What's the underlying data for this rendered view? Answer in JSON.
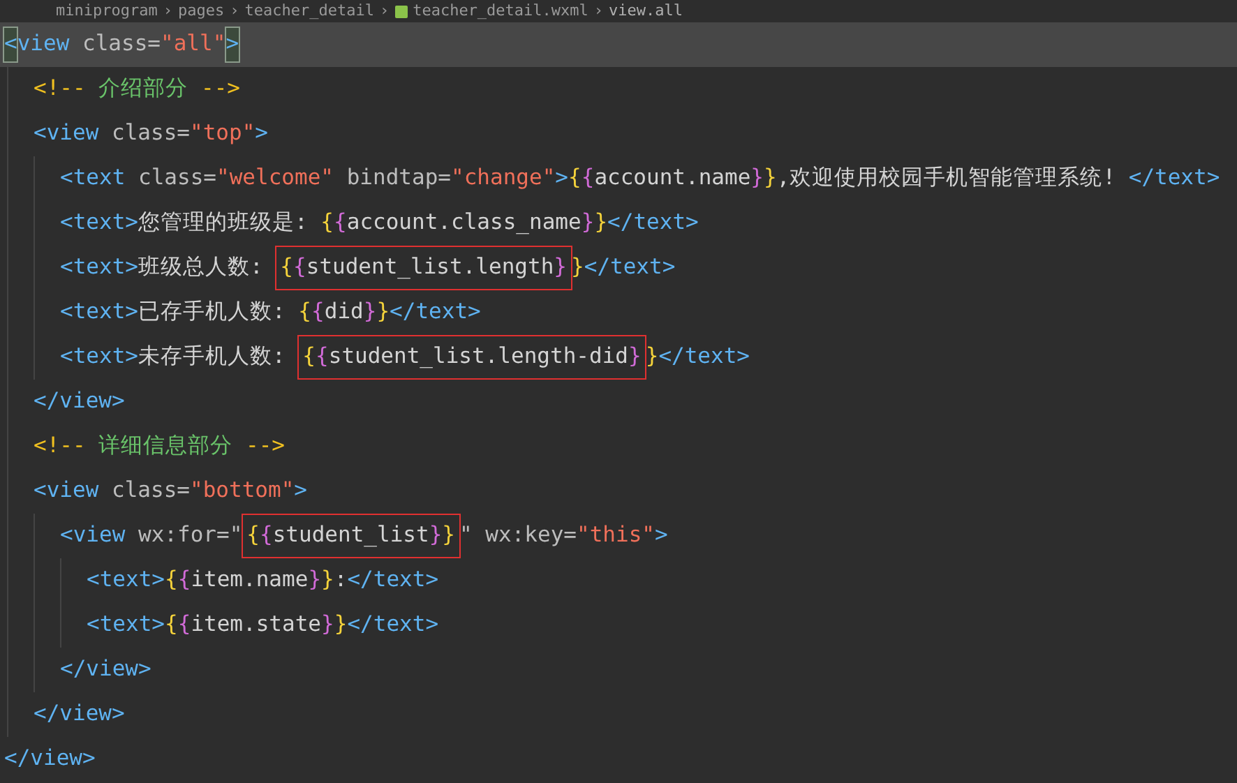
{
  "breadcrumb": [
    {
      "text": "miniprogram",
      "kind": "folder"
    },
    {
      "text": "›",
      "kind": "separator"
    },
    {
      "text": "pages",
      "kind": "folder"
    },
    {
      "text": "›",
      "kind": "separator"
    },
    {
      "text": "teacher_detail",
      "kind": "folder"
    },
    {
      "text": "›",
      "kind": "separator"
    },
    {
      "text": "teacher_detail.wxml",
      "kind": "file"
    },
    {
      "text": "›",
      "kind": "separator"
    },
    {
      "text": "view.all",
      "kind": "symbol"
    }
  ],
  "lines": [
    {
      "current": true,
      "tokens": [
        {
          "kind": "tag",
          "text": "<",
          "matched": true
        },
        {
          "kind": "tag",
          "text": "view "
        },
        {
          "kind": "attr",
          "text": "class="
        },
        {
          "kind": "string",
          "text": "\"all\""
        },
        {
          "kind": "tag",
          "text": ">",
          "matched": true
        }
      ],
      "children": [
        {
          "tokens": [
            {
              "kind": "punct",
              "text": "<!--"
            },
            {
              "kind": "comment",
              "text": " 介绍部分 "
            },
            {
              "kind": "punct",
              "text": "-->"
            }
          ]
        },
        {
          "tokens": [
            {
              "kind": "tag",
              "text": "<view "
            },
            {
              "kind": "attr",
              "text": "class="
            },
            {
              "kind": "string",
              "text": "\"top\""
            },
            {
              "kind": "tag",
              "text": ">"
            }
          ],
          "children": [
            {
              "tokens": [
                {
                  "kind": "tag",
                  "text": "<text "
                },
                {
                  "kind": "attr",
                  "text": "class="
                },
                {
                  "kind": "string",
                  "text": "\"welcome\""
                },
                {
                  "kind": "attr",
                  "text": " bindtap="
                },
                {
                  "kind": "string",
                  "text": "\"change\""
                },
                {
                  "kind": "tag",
                  "text": ">"
                },
                {
                  "kind": "brace1",
                  "text": "{"
                },
                {
                  "kind": "brace2",
                  "text": "{"
                },
                {
                  "kind": "text",
                  "text": "account.name"
                },
                {
                  "kind": "brace2",
                  "text": "}"
                },
                {
                  "kind": "brace1",
                  "text": "}"
                },
                {
                  "kind": "text",
                  "text": ",欢迎使用校园手机智能管理系统! "
                },
                {
                  "kind": "tag",
                  "text": "</text>"
                }
              ]
            },
            {
              "tokens": [
                {
                  "kind": "tag",
                  "text": "<text>"
                },
                {
                  "kind": "text",
                  "text": "您管理的班级是: "
                },
                {
                  "kind": "brace1",
                  "text": "{"
                },
                {
                  "kind": "brace2",
                  "text": "{"
                },
                {
                  "kind": "text",
                  "text": "account.class_name"
                },
                {
                  "kind": "brace2",
                  "text": "}"
                },
                {
                  "kind": "brace1",
                  "text": "}"
                },
                {
                  "kind": "tag",
                  "text": "</text>"
                }
              ]
            },
            {
              "tokens": [
                {
                  "kind": "tag",
                  "text": "<text>"
                },
                {
                  "kind": "text",
                  "text": "班级总人数: "
                },
                {
                  "kind": "boxed",
                  "parts": [
                    {
                      "kind": "brace1",
                      "text": "{"
                    },
                    {
                      "kind": "brace2",
                      "text": "{"
                    },
                    {
                      "kind": "text",
                      "text": "student_list.length"
                    },
                    {
                      "kind": "brace2",
                      "text": "}"
                    }
                  ]
                },
                {
                  "kind": "brace1",
                  "text": "}"
                },
                {
                  "kind": "tag",
                  "text": "</text>"
                }
              ]
            },
            {
              "tokens": [
                {
                  "kind": "tag",
                  "text": "<text>"
                },
                {
                  "kind": "text",
                  "text": "已存手机人数: "
                },
                {
                  "kind": "brace1",
                  "text": "{"
                },
                {
                  "kind": "brace2",
                  "text": "{"
                },
                {
                  "kind": "text",
                  "text": "did"
                },
                {
                  "kind": "brace2",
                  "text": "}"
                },
                {
                  "kind": "brace1",
                  "text": "}"
                },
                {
                  "kind": "tag",
                  "text": "</text>"
                }
              ]
            },
            {
              "tokens": [
                {
                  "kind": "tag",
                  "text": "<text>"
                },
                {
                  "kind": "text",
                  "text": "未存手机人数: "
                },
                {
                  "kind": "boxed",
                  "parts": [
                    {
                      "kind": "brace1",
                      "text": "{"
                    },
                    {
                      "kind": "brace2",
                      "text": "{"
                    },
                    {
                      "kind": "text",
                      "text": "student_list.length-did"
                    },
                    {
                      "kind": "brace2",
                      "text": "}"
                    }
                  ]
                },
                {
                  "kind": "brace1",
                  "text": "}"
                },
                {
                  "kind": "tag",
                  "text": "</text>"
                }
              ]
            }
          ]
        },
        {
          "tokens": [
            {
              "kind": "tag",
              "text": "</view>"
            }
          ]
        },
        {
          "tokens": [
            {
              "kind": "punct",
              "text": "<!--"
            },
            {
              "kind": "comment",
              "text": " 详细信息部分 "
            },
            {
              "kind": "punct",
              "text": "-->"
            }
          ]
        },
        {
          "tokens": [
            {
              "kind": "tag",
              "text": "<view "
            },
            {
              "kind": "attr",
              "text": "class="
            },
            {
              "kind": "string",
              "text": "\"bottom\""
            },
            {
              "kind": "tag",
              "text": ">"
            }
          ],
          "children": [
            {
              "tokens": [
                {
                  "kind": "tag",
                  "text": "<view "
                },
                {
                  "kind": "attr",
                  "text": "wx:for=\""
                },
                {
                  "kind": "boxed",
                  "parts": [
                    {
                      "kind": "brace1",
                      "text": "{"
                    },
                    {
                      "kind": "brace2",
                      "text": "{"
                    },
                    {
                      "kind": "text",
                      "text": "student_list"
                    },
                    {
                      "kind": "brace2",
                      "text": "}"
                    },
                    {
                      "kind": "brace1",
                      "text": "}"
                    }
                  ]
                },
                {
                  "kind": "attr",
                  "text": "\" wx:key="
                },
                {
                  "kind": "string",
                  "text": "\"this\""
                },
                {
                  "kind": "tag",
                  "text": ">"
                }
              ],
              "children": [
                {
                  "tokens": [
                    {
                      "kind": "tag",
                      "text": "<text>"
                    },
                    {
                      "kind": "brace1",
                      "text": "{"
                    },
                    {
                      "kind": "brace2",
                      "text": "{"
                    },
                    {
                      "kind": "text",
                      "text": "item.name"
                    },
                    {
                      "kind": "brace2",
                      "text": "}"
                    },
                    {
                      "kind": "brace1",
                      "text": "}"
                    },
                    {
                      "kind": "text",
                      "text": ":"
                    },
                    {
                      "kind": "tag",
                      "text": "</text>"
                    }
                  ]
                },
                {
                  "tokens": [
                    {
                      "kind": "tag",
                      "text": "<text>"
                    },
                    {
                      "kind": "brace1",
                      "text": "{"
                    },
                    {
                      "kind": "brace2",
                      "text": "{"
                    },
                    {
                      "kind": "text",
                      "text": "item.state"
                    },
                    {
                      "kind": "brace2",
                      "text": "}"
                    },
                    {
                      "kind": "brace1",
                      "text": "}"
                    },
                    {
                      "kind": "tag",
                      "text": "</text>"
                    }
                  ]
                }
              ]
            },
            {
              "tokens": [
                {
                  "kind": "tag",
                  "text": "</view>"
                }
              ]
            }
          ]
        },
        {
          "tokens": [
            {
              "kind": "tag",
              "text": "</view>"
            }
          ]
        }
      ]
    },
    {
      "tokens": [
        {
          "kind": "tag",
          "text": "</view>"
        }
      ]
    }
  ]
}
